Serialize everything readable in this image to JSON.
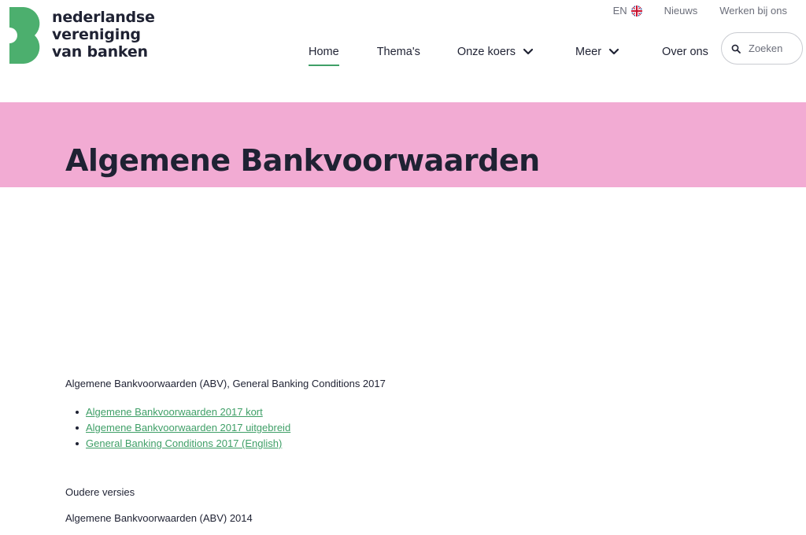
{
  "brand": {
    "name_lines": [
      "nederlandse",
      "vereniging",
      "van banken"
    ],
    "logo_icon": "nvb-b-icon",
    "color_green": "#4caf6e",
    "color_pink": "#f2abd3",
    "color_link": "#3f9f67"
  },
  "top_links": {
    "language_label": "EN",
    "language_icon": "uk-flag-icon",
    "news": "Nieuws",
    "jobs": "Werken bij ons"
  },
  "nav": {
    "items": [
      {
        "label": "Home",
        "active": true
      },
      {
        "label": "Thema's"
      },
      {
        "label": "Onze koers",
        "has_dropdown": true
      },
      {
        "label": "Meer",
        "has_dropdown": true
      },
      {
        "label": "Over ons"
      }
    ]
  },
  "search": {
    "placeholder": "Zoeken",
    "icon": "search-icon"
  },
  "page": {
    "title": "Algemene Bankvoorwaarden"
  },
  "content": {
    "intro": "Algemene Bankvoorwaarden (ABV), General Banking Conditions 2017",
    "documents": [
      "Algemene Bankvoorwaarden 2017 kort",
      "Algemene Bankvoorwaarden 2017 uitgebreid",
      "General Banking Conditions 2017 (English)"
    ],
    "older_heading": "Oudere versies",
    "abv_2014": "Algemene Bankvoorwaarden (ABV) 2014"
  }
}
